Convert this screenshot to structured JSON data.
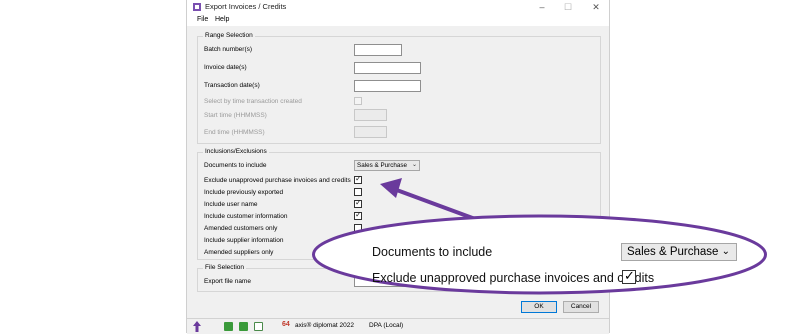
{
  "window": {
    "title": "Export Invoices / Credits",
    "controls": {
      "minimize": "–",
      "maximize": "☐",
      "close": "✕"
    }
  },
  "menu": [
    "File",
    "Help"
  ],
  "range_selection": {
    "title": "Range Selection",
    "batch_numbers": "Batch number(s)",
    "invoice_dates": "Invoice date(s)",
    "transaction_dates": "Transaction date(s)",
    "select_by_time": "Select by time transaction created",
    "start_time": "Start time (HHMMSS)",
    "end_time": "End time (HHMMSS)"
  },
  "inclusions": {
    "title": "Inclusions/Exclusions",
    "documents_label": "Documents to include",
    "documents_value": "Sales & Purchase",
    "items": [
      {
        "label": "Exclude unapproved purchase invoices and credits",
        "checked": true
      },
      {
        "label": "Include previously exported",
        "checked": false
      },
      {
        "label": "Include user name",
        "checked": true
      },
      {
        "label": "Include customer information",
        "checked": true
      },
      {
        "label": "Amended customers only",
        "checked": false
      },
      {
        "label": "Include supplier information",
        "checked": true
      },
      {
        "label": "Amended suppliers only",
        "checked": false
      }
    ]
  },
  "file_selection": {
    "title": "File Selection",
    "export_file_name": "Export file name"
  },
  "buttons": {
    "ok": "OK",
    "cancel": "Cancel"
  },
  "status": {
    "product": "axis® diplomat 2022",
    "database": "DPA (Local)"
  },
  "zoom_callout": {
    "documents_label": "Documents to include",
    "documents_value": "Sales & Purchase",
    "exclude_label": "Exclude unapproved purchase invoices and credits",
    "exclude_checked": true
  },
  "colors": {
    "callout": "#6a3a9c",
    "dialog_bg": "#f0f0f0",
    "default_button": "#0078d7"
  }
}
